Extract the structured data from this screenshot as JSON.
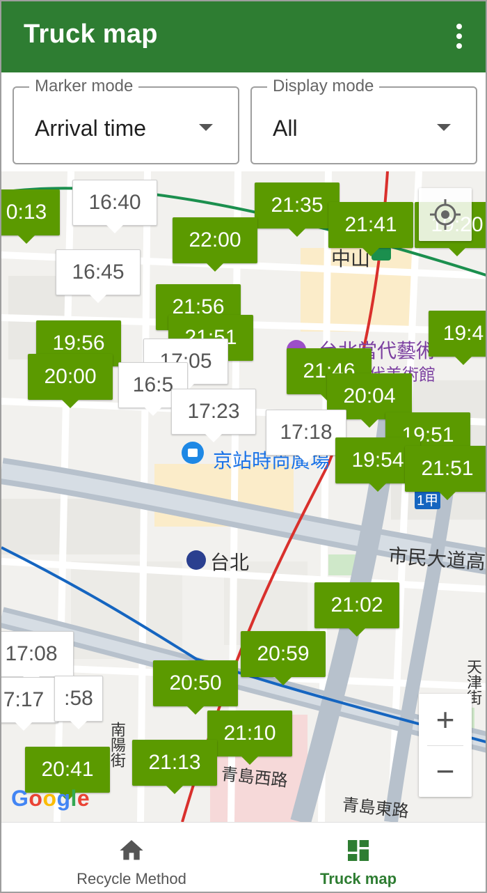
{
  "app_bar": {
    "title": "Truck map",
    "menu_icon": "more-vert-icon"
  },
  "filters": {
    "marker_mode": {
      "label": "Marker mode",
      "value": "Arrival time"
    },
    "display_mode": {
      "label": "Display mode",
      "value": "All"
    }
  },
  "map": {
    "labels": {
      "station_main": "台北",
      "mall": "京站時尚廣場",
      "museum_line1": "台北當代藝術",
      "museum_line2": "代美術館",
      "zhongshan": "中山",
      "civic_blvd": "市民大道高架",
      "qingdao_w": "青島西路",
      "qingdao_e": "青島東路",
      "nanyang": "南陽街",
      "tianjin": "天津街",
      "exit": "1甲"
    },
    "markers": [
      {
        "t": "0:13",
        "c": "green"
      },
      {
        "t": "16:40",
        "c": "white"
      },
      {
        "t": "21:35",
        "c": "green"
      },
      {
        "t": "21:41",
        "c": "green"
      },
      {
        "t": "19:20",
        "c": "green"
      },
      {
        "t": "22:00",
        "c": "green"
      },
      {
        "t": "16:45",
        "c": "white"
      },
      {
        "t": "21:56",
        "c": "green"
      },
      {
        "t": "19:56",
        "c": "green"
      },
      {
        "t": "21:51",
        "c": "green"
      },
      {
        "t": "17:05",
        "c": "white"
      },
      {
        "t": "20:00",
        "c": "green"
      },
      {
        "t": "16:5",
        "c": "white"
      },
      {
        "t": "19:4",
        "c": "green"
      },
      {
        "t": "21:46",
        "c": "green"
      },
      {
        "t": "20:04",
        "c": "green"
      },
      {
        "t": "17:23",
        "c": "white"
      },
      {
        "t": "17:18",
        "c": "white"
      },
      {
        "t": "19:51",
        "c": "green"
      },
      {
        "t": "19:54",
        "c": "green"
      },
      {
        "t": "21:51",
        "c": "green"
      },
      {
        "t": "21:02",
        "c": "green"
      },
      {
        "t": "17:08",
        "c": "white"
      },
      {
        "t": "20:59",
        "c": "green"
      },
      {
        "t": "20:50",
        "c": "green"
      },
      {
        "t": "7:17",
        "c": "white"
      },
      {
        "t": ":58",
        "c": "white"
      },
      {
        "t": "21:10",
        "c": "green"
      },
      {
        "t": "20:41",
        "c": "green"
      },
      {
        "t": "21:13",
        "c": "green"
      }
    ],
    "zoom_in": "+",
    "zoom_out": "−",
    "attribution": "Google"
  },
  "bottom_nav": {
    "items": [
      {
        "label": "Recycle Method",
        "icon": "home-icon",
        "active": false
      },
      {
        "label": "Truck map",
        "icon": "dashboard-icon",
        "active": true
      }
    ]
  },
  "colors": {
    "primary": "#2e7d32",
    "marker_green": "#5b9a00",
    "active_nav": "#2e7d32"
  }
}
